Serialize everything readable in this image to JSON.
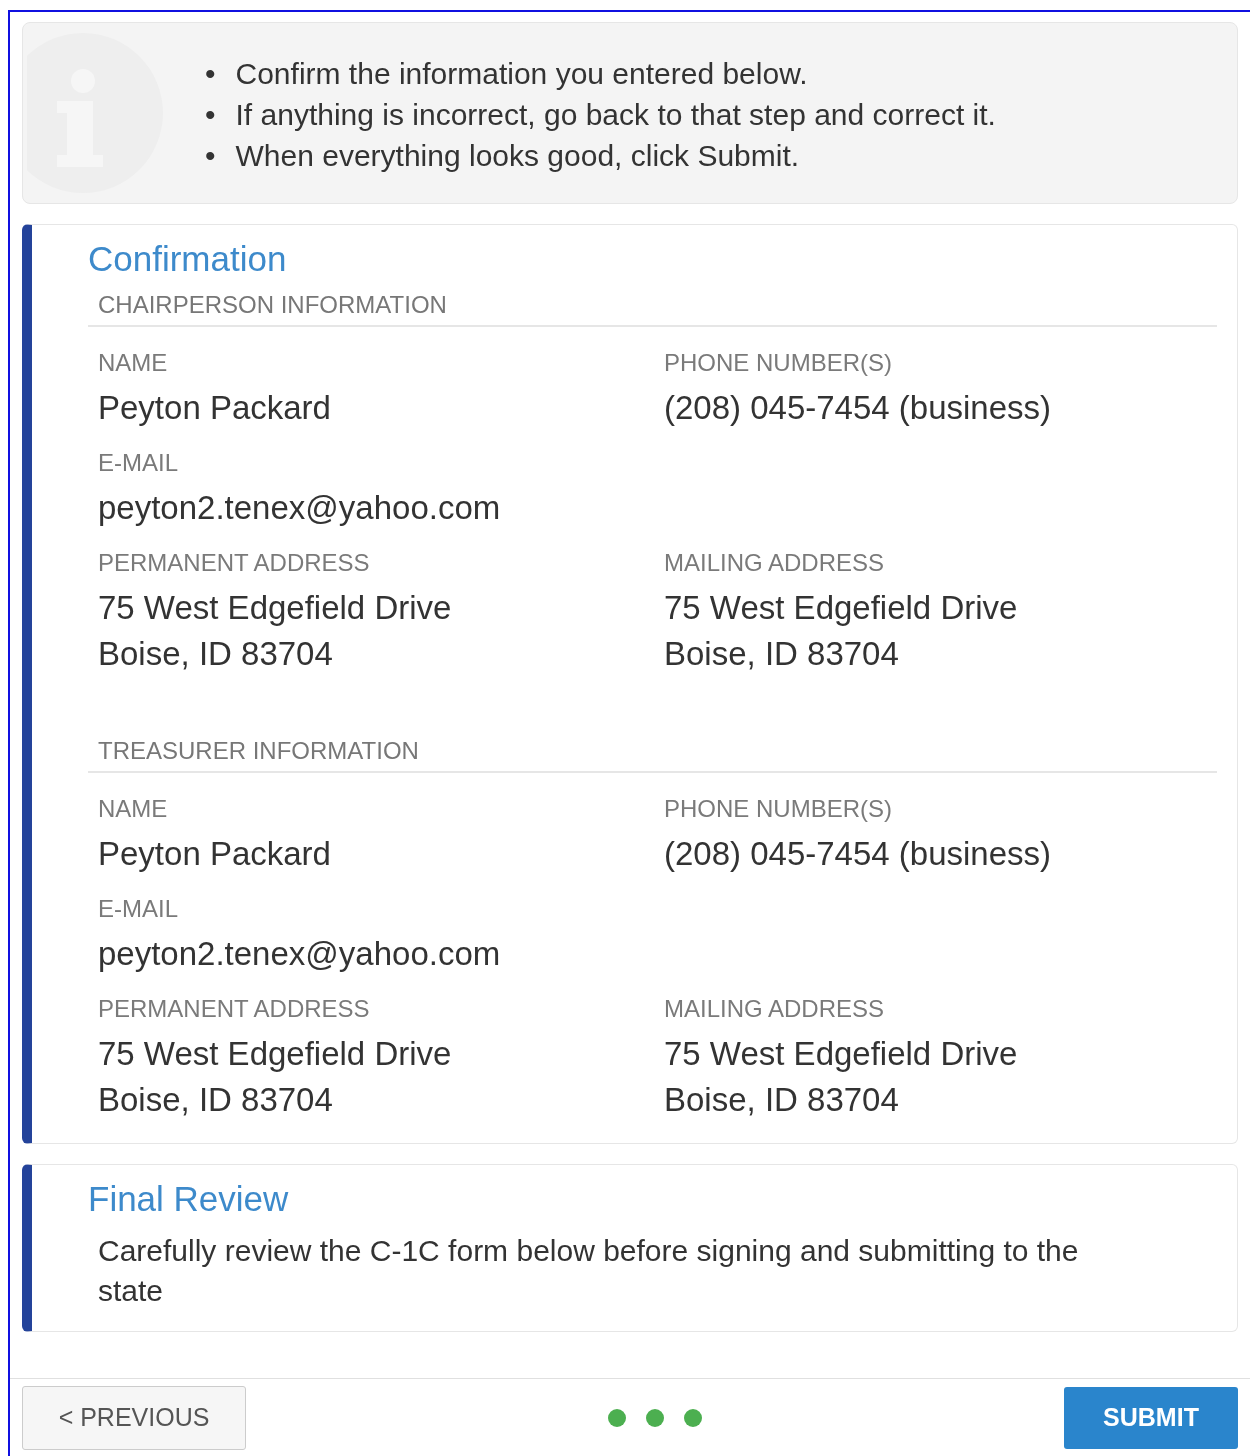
{
  "notice": {
    "bullet": "•",
    "items": [
      "Confirm the information you entered below.",
      "If anything is incorrect, go back to that step and correct it.",
      "When everything looks good, click Submit."
    ]
  },
  "confirmation": {
    "title": "Confirmation",
    "sections": [
      {
        "heading": "CHAIRPERSON INFORMATION",
        "fields": [
          {
            "kind": "half",
            "label": "NAME",
            "lines": [
              "Peyton Packard"
            ]
          },
          {
            "kind": "half",
            "label": "PHONE NUMBER(S)",
            "lines": [
              "(208) 045-7454 (business)"
            ]
          },
          {
            "kind": "full",
            "label": "E-MAIL",
            "lines": [
              "peyton2.tenex@yahoo.com"
            ]
          },
          {
            "kind": "half",
            "label": "PERMANENT ADDRESS",
            "lines": [
              "75 West Edgefield Drive",
              "Boise, ID 83704"
            ]
          },
          {
            "kind": "half",
            "label": "MAILING ADDRESS",
            "lines": [
              "75 West Edgefield Drive",
              "Boise, ID 83704"
            ]
          }
        ]
      },
      {
        "heading": "TREASURER INFORMATION",
        "fields": [
          {
            "kind": "half",
            "label": "NAME",
            "lines": [
              "Peyton Packard"
            ]
          },
          {
            "kind": "half",
            "label": "PHONE NUMBER(S)",
            "lines": [
              "(208) 045-7454 (business)"
            ]
          },
          {
            "kind": "full",
            "label": "E-MAIL",
            "lines": [
              "peyton2.tenex@yahoo.com"
            ]
          },
          {
            "kind": "half",
            "label": "PERMANENT ADDRESS",
            "lines": [
              "75 West Edgefield Drive",
              "Boise, ID 83704"
            ]
          },
          {
            "kind": "half",
            "label": "MAILING ADDRESS",
            "lines": [
              "75 West Edgefield Drive",
              "Boise, ID 83704"
            ]
          }
        ]
      }
    ]
  },
  "final_review": {
    "title": "Final Review",
    "text": "Carefully review the C-1C form below before signing and submitting to the state"
  },
  "footer": {
    "previous": "< PREVIOUS",
    "submit": "SUBMIT"
  }
}
